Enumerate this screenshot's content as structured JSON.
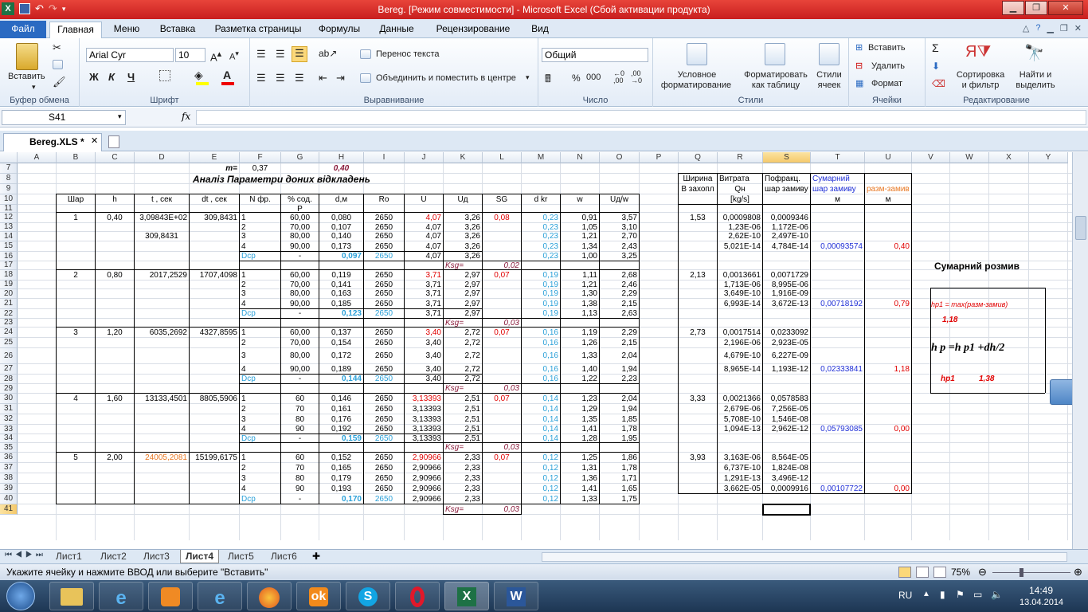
{
  "window": {
    "title": "Bereg. [Режим совместимости] - Microsoft Excel (Сбой активации продукта)"
  },
  "tabs": [
    "Файл",
    "Главная",
    "Меню",
    "Вставка",
    "Разметка страницы",
    "Формулы",
    "Данные",
    "Рецензирование",
    "Вид"
  ],
  "ribbon": {
    "paste": "Вставить",
    "clipboard": "Буфер обмена",
    "font_name": "Arial Cyr",
    "font_size": "10",
    "font_group": "Шрифт",
    "bold": "Ж",
    "italic": "К",
    "underline": "Ч",
    "wrap": "Перенос текста",
    "merge": "Объединить и поместить в центре",
    "align_group": "Выравнивание",
    "number_format": "Общий",
    "number_group": "Число",
    "percent": "%",
    "thousands": "000",
    "cond_format_1": "Условное",
    "cond_format_2": "форматирование",
    "table_fmt_1": "Форматировать",
    "table_fmt_2": "как таблицу",
    "cell_styles_1": "Стили",
    "cell_styles_2": "ячеек",
    "styles_group": "Стили",
    "insert": "Вставить",
    "delete": "Удалить",
    "format": "Формат",
    "cells_group": "Ячейки",
    "sort_1": "Сортировка",
    "sort_2": "и фильтр",
    "find_1": "Найти и",
    "find_2": "выделить",
    "editing_group": "Редактирование"
  },
  "formula_bar": {
    "name_box": "S41",
    "fx": "fx",
    "value": ""
  },
  "doc_tab": "Bereg.XLS *",
  "columns": [
    "A",
    "B",
    "C",
    "D",
    "E",
    "F",
    "G",
    "H",
    "I",
    "J",
    "K",
    "L",
    "M",
    "N",
    "O",
    "P",
    "Q",
    "R",
    "S",
    "T",
    "U",
    "V",
    "W",
    "X",
    "Y"
  ],
  "rows": [
    "7",
    "8",
    "9",
    "10",
    "11",
    "12",
    "13",
    "14",
    "15",
    "16",
    "17",
    "18",
    "19",
    "20",
    "21",
    "22",
    "23",
    "24",
    "25",
    "26",
    "27",
    "28",
    "29",
    "30",
    "31",
    "32",
    "33",
    "34",
    "35",
    "36",
    "37",
    "38",
    "39",
    "40",
    "41"
  ],
  "sheet": {
    "m_label": "m=",
    "m_value": "0,37",
    "h_top": "0,40",
    "title": "Аналіз Параметри доних відкладень",
    "headers": [
      "Шар",
      "h",
      "t , сек",
      "dt , сек",
      "N фр.",
      "% сод.",
      "d,м",
      "Ro",
      "U",
      "Uд",
      "SG",
      "d kr",
      "w",
      "Uд/w"
    ],
    "header_p": "P",
    "right_headers": {
      "q1": "Ширина",
      "q2": "В захопл",
      "r1": "Витрата",
      "r2": "Qн",
      "r3": "[kg/s]",
      "s1": "Пофракц.",
      "s2": "шар замиву",
      "t1": "Сумарний",
      "t2": "шар замиву",
      "t3": "м",
      "u1": "разм-замив",
      "u2": "м"
    },
    "ksg": "Ksg=",
    "dcp": "Dср",
    "dash": "-",
    "layers": [
      {
        "n": "1",
        "h": "0,40",
        "t": "3,09843E+02",
        "t2": "309,8431",
        "dt": "309,8431",
        "ksg": "0,02",
        "q": "1,53",
        "sg": "0,08",
        "tsum": "0,00093574",
        "u": "0,40",
        "fr": [
          [
            "1",
            "60,00",
            "0,080",
            "2650",
            "4,07",
            "3,26",
            "0,23",
            "0,91",
            "3,57",
            "0,0009808",
            "0,0009346"
          ],
          [
            "2",
            "70,00",
            "0,107",
            "2650",
            "4,07",
            "3,26",
            "0,23",
            "1,05",
            "3,10",
            "1,23E-06",
            "1,172E-06"
          ],
          [
            "3",
            "80,00",
            "0,140",
            "2650",
            "4,07",
            "3,26",
            "0,23",
            "1,21",
            "2,70",
            "2,62E-10",
            "2,497E-10"
          ],
          [
            "4",
            "90,00",
            "0,173",
            "2650",
            "4,07",
            "3,26",
            "0,23",
            "1,34",
            "2,43",
            "5,021E-14",
            "4,784E-14"
          ]
        ],
        "avg": [
          "0,097",
          "2650",
          "4,07",
          "3,26",
          "0,23",
          "1,00",
          "3,25"
        ]
      },
      {
        "n": "2",
        "h": "0,80",
        "t": "2017,2529",
        "dt": "1707,4098",
        "ksg": "0,03",
        "q": "2,13",
        "sg": "0,07",
        "tsum": "0,00718192",
        "u": "0,79",
        "fr": [
          [
            "1",
            "60,00",
            "0,119",
            "2650",
            "3,71",
            "2,97",
            "0,19",
            "1,11",
            "2,68",
            "0,0013661",
            "0,0071729"
          ],
          [
            "2",
            "70,00",
            "0,141",
            "2650",
            "3,71",
            "2,97",
            "0,19",
            "1,21",
            "2,46",
            "1,713E-06",
            "8,995E-06"
          ],
          [
            "3",
            "80,00",
            "0,163",
            "2650",
            "3,71",
            "2,97",
            "0,19",
            "1,30",
            "2,29",
            "3,649E-10",
            "1,916E-09"
          ],
          [
            "4",
            "90,00",
            "0,185",
            "2650",
            "3,71",
            "2,97",
            "0,19",
            "1,38",
            "2,15",
            "6,993E-14",
            "3,672E-13"
          ]
        ],
        "avg": [
          "0,123",
          "2650",
          "3,71",
          "2,97",
          "0,19",
          "1,13",
          "2,63"
        ]
      },
      {
        "n": "3",
        "h": "1,20",
        "t": "6035,2692",
        "dt": "4327,8595",
        "ksg": "0,03",
        "q": "2,73",
        "sg": "0,07",
        "tsum": "0,02333841",
        "u": "1,18",
        "fr": [
          [
            "1",
            "60,00",
            "0,137",
            "2650",
            "3,40",
            "2,72",
            "0,16",
            "1,19",
            "2,29",
            "0,0017514",
            "0,0233092"
          ],
          [
            "2",
            "70,00",
            "0,154",
            "2650",
            "3,40",
            "2,72",
            "0,16",
            "1,26",
            "2,15",
            "2,196E-06",
            "2,923E-05"
          ],
          [
            "3",
            "80,00",
            "0,172",
            "2650",
            "3,40",
            "2,72",
            "0,16",
            "1,33",
            "2,04",
            "4,679E-10",
            "6,227E-09"
          ],
          [
            "4",
            "90,00",
            "0,189",
            "2650",
            "3,40",
            "2,72",
            "0,16",
            "1,40",
            "1,94",
            "8,965E-14",
            "1,193E-12"
          ]
        ],
        "avg": [
          "0,144",
          "2650",
          "3,40",
          "2,72",
          "0,16",
          "1,22",
          "2,23"
        ]
      },
      {
        "n": "4",
        "h": "1,60",
        "t": "13133,4501",
        "dt": "8805,5906",
        "ksg": "0,03",
        "q": "3,33",
        "sg": "0,07",
        "tsum": "0,05793085",
        "u": "0,00",
        "fr": [
          [
            "1",
            "60",
            "0,146",
            "2650",
            "3,13393",
            "2,51",
            "0,14",
            "1,23",
            "2,04",
            "0,0021366",
            "0,0578583"
          ],
          [
            "2",
            "70",
            "0,161",
            "2650",
            "3,13393",
            "2,51",
            "0,14",
            "1,29",
            "1,94",
            "2,679E-06",
            "7,256E-05"
          ],
          [
            "3",
            "80",
            "0,176",
            "2650",
            "3,13393",
            "2,51",
            "0,14",
            "1,35",
            "1,85",
            "5,708E-10",
            "1,546E-08"
          ],
          [
            "4",
            "90",
            "0,192",
            "2650",
            "3,13393",
            "2,51",
            "0,14",
            "1,41",
            "1,78",
            "1,094E-13",
            "2,962E-12"
          ]
        ],
        "avg": [
          "0,159",
          "2650",
          "3,13393",
          "2,51",
          "0,14",
          "1,28",
          "1,95"
        ]
      },
      {
        "n": "5",
        "h": "2,00",
        "t": "24005,2081",
        "dt": "15199,6175",
        "ksg": "0,03",
        "q": "3,93",
        "sg": "0,07",
        "tsum": "0,00107722",
        "u": "0,00",
        "fr": [
          [
            "1",
            "60",
            "0,152",
            "2650",
            "2,90966",
            "2,33",
            "0,12",
            "1,25",
            "1,86",
            "3,163E-06",
            "8,564E-05"
          ],
          [
            "2",
            "70",
            "0,165",
            "2650",
            "2,90966",
            "2,33",
            "0,12",
            "1,31",
            "1,78",
            "6,737E-10",
            "1,824E-08"
          ],
          [
            "3",
            "80",
            "0,179",
            "2650",
            "2,90966",
            "2,33",
            "0,12",
            "1,36",
            "1,71",
            "1,291E-13",
            "3,496E-12"
          ],
          [
            "4",
            "90",
            "0,193",
            "2650",
            "2,90966",
            "2,33",
            "0,12",
            "1,41",
            "1,65",
            "3,662E-05",
            "0,0009916"
          ]
        ],
        "avg": [
          "0,170",
          "2650",
          "2,90966",
          "2,33",
          "0,12",
          "1,33",
          "1,75"
        ]
      }
    ],
    "side": {
      "title": "Сумарний розмив",
      "hp1_formula": "hp1  = max(разм-замив)",
      "hp1_val": "1,18",
      "eq": "h p =h p1 +dh/2",
      "hp_label": "hp1",
      "hp_val": "1,38"
    }
  },
  "sheet_tabs": [
    "Лист1",
    "Лист2",
    "Лист3",
    "Лист4",
    "Лист5",
    "Лист6"
  ],
  "active_sheet": "Лист4",
  "status": {
    "text": "Укажите ячейку и нажмите ВВОД или выберите \"Вставить\"",
    "zoom": "75%"
  },
  "taskbar": {
    "lang": "RU",
    "time": "14:49",
    "date": "13.04.2014"
  }
}
